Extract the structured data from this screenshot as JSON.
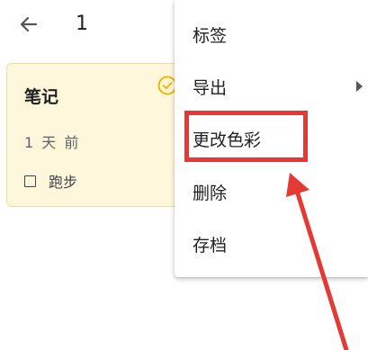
{
  "topbar": {
    "selected_count": "1"
  },
  "note": {
    "title": "笔记",
    "time": "1 天 前",
    "todo_item": "跑步"
  },
  "menu": {
    "items": [
      "标签",
      "导出",
      "更改色彩",
      "删除",
      "存档"
    ]
  },
  "colors": {
    "card_background": "#fff7dc",
    "card_border": "#f1dc9a",
    "check_accent": "#f4b400",
    "annotation": "#e53935"
  }
}
